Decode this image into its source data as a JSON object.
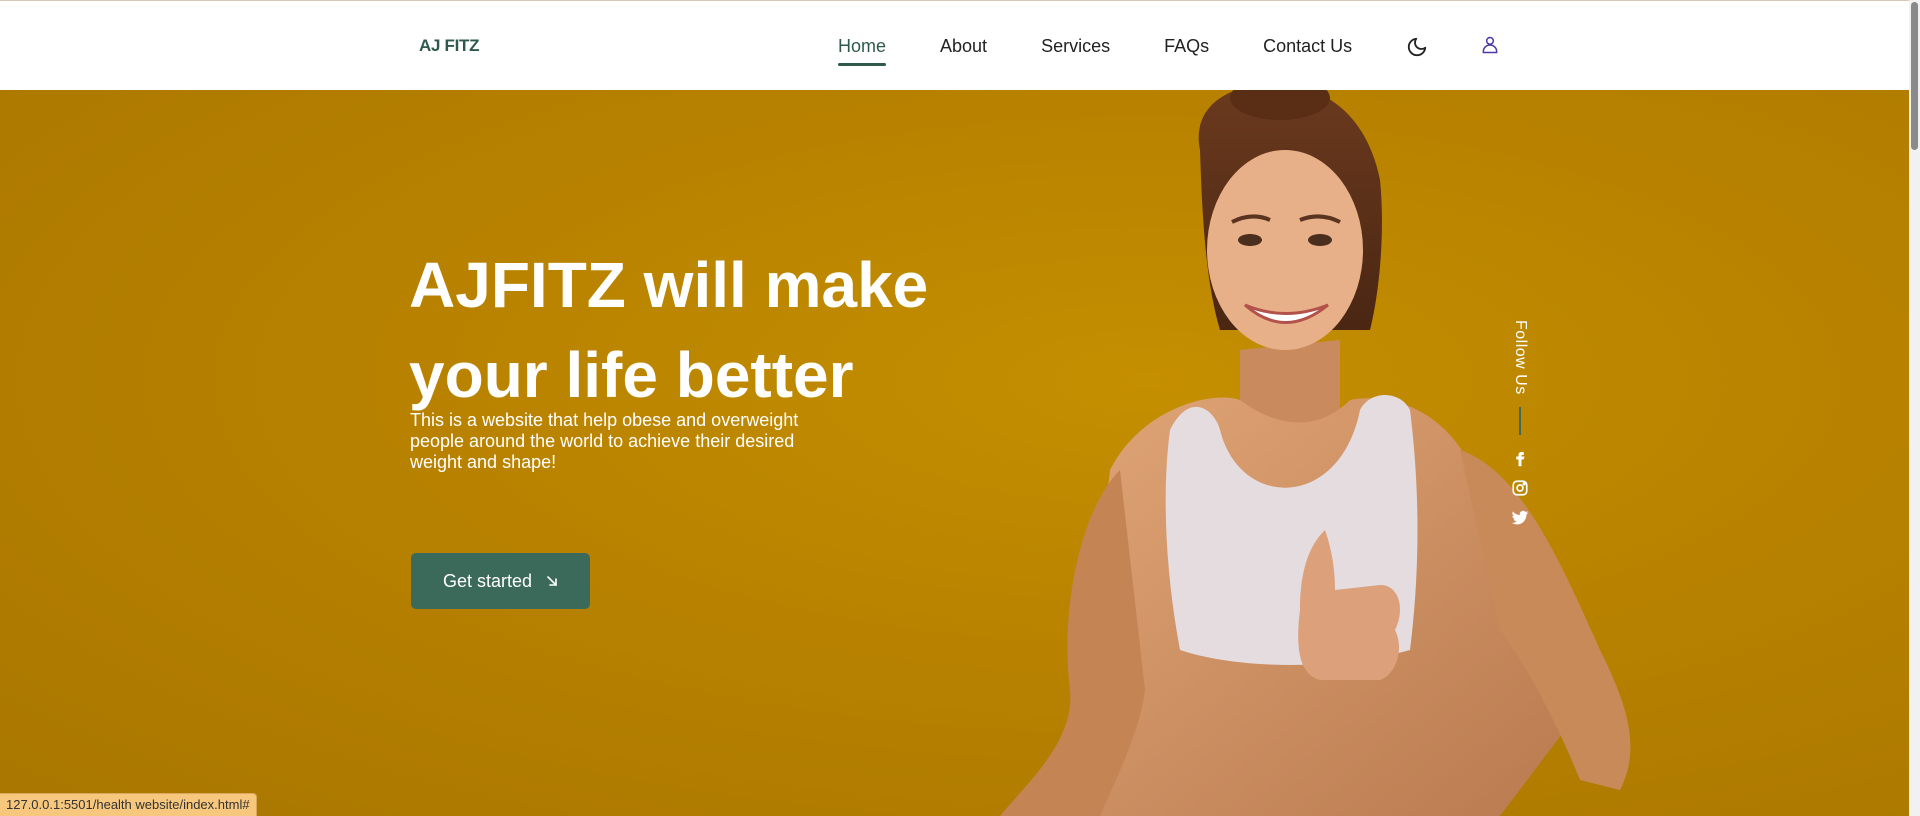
{
  "header": {
    "logo": "AJ FITZ",
    "nav": [
      {
        "label": "Home",
        "active": true
      },
      {
        "label": "About",
        "active": false
      },
      {
        "label": "Services",
        "active": false
      },
      {
        "label": "FAQs",
        "active": false
      },
      {
        "label": "Contact Us",
        "active": false
      }
    ],
    "theme_toggle_icon": "moon-icon",
    "account_icon": "user-icon"
  },
  "hero": {
    "title": "AJFITZ will make your life better",
    "subtitle": "This is a website that help obese and overweight people around the world to achieve their desired weight and shape!",
    "cta_label": "Get started",
    "cta_icon": "arrow-down-right-icon",
    "image_icon": "woman-thumbs-up-photo"
  },
  "follow": {
    "label": "Follow Us",
    "socials": [
      "facebook-icon",
      "instagram-icon",
      "twitter-icon"
    ]
  },
  "status_bar": {
    "url": "127.0.0.1:5501/health website/index.html#"
  },
  "colors": {
    "accent": "#3b6a5a",
    "hero_bg": "#b8860b",
    "header_bg": "#ffffff"
  }
}
